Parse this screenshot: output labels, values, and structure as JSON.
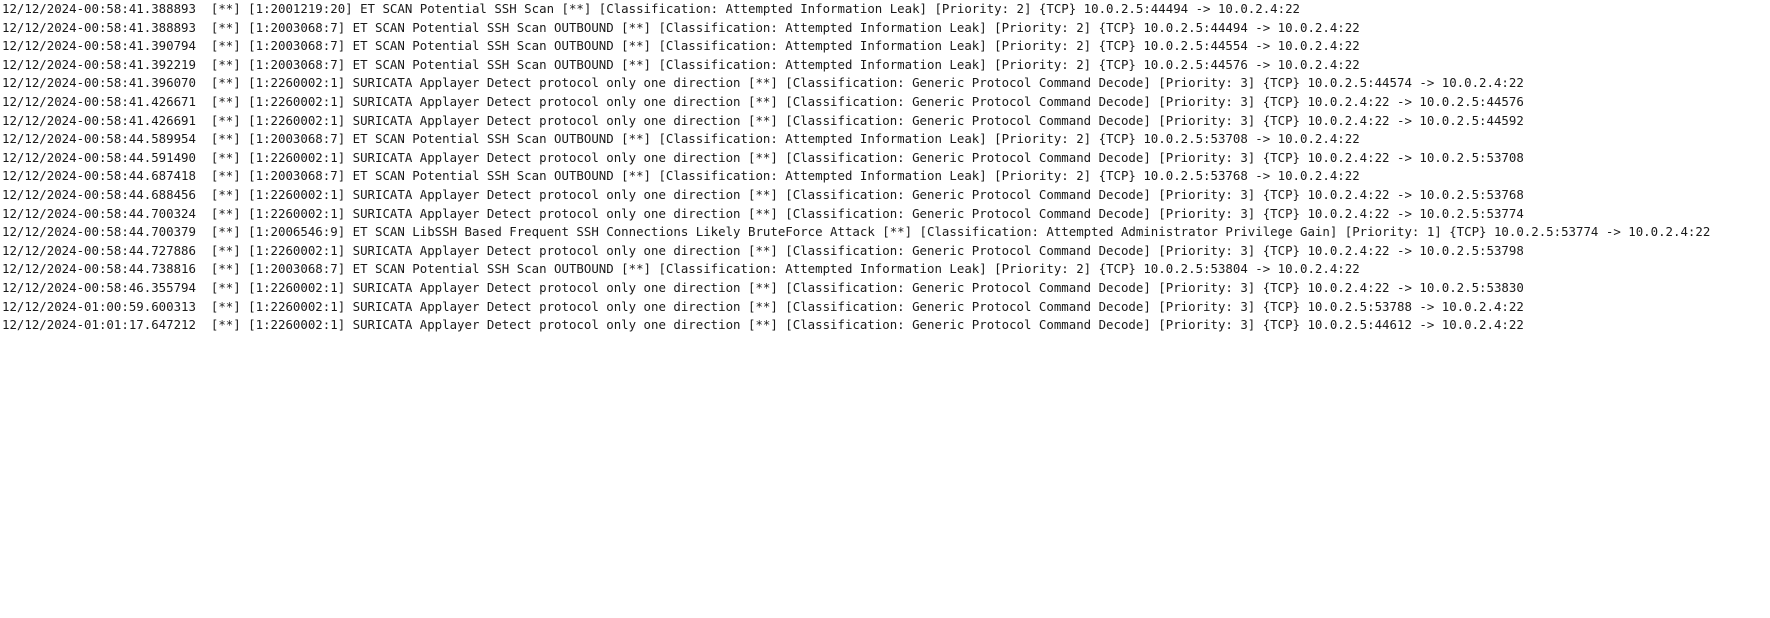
{
  "log_lines": [
    "12/12/2024-00:58:41.388893  [**] [1:2001219:20] ET SCAN Potential SSH Scan [**] [Classification: Attempted Information Leak] [Priority: 2] {TCP} 10.0.2.5:44494 -> 10.0.2.4:22",
    "12/12/2024-00:58:41.388893  [**] [1:2003068:7] ET SCAN Potential SSH Scan OUTBOUND [**] [Classification: Attempted Information Leak] [Priority: 2] {TCP} 10.0.2.5:44494 -> 10.0.2.4:22",
    "12/12/2024-00:58:41.390794  [**] [1:2003068:7] ET SCAN Potential SSH Scan OUTBOUND [**] [Classification: Attempted Information Leak] [Priority: 2] {TCP} 10.0.2.5:44554 -> 10.0.2.4:22",
    "12/12/2024-00:58:41.392219  [**] [1:2003068:7] ET SCAN Potential SSH Scan OUTBOUND [**] [Classification: Attempted Information Leak] [Priority: 2] {TCP} 10.0.2.5:44576 -> 10.0.2.4:22",
    "12/12/2024-00:58:41.396070  [**] [1:2260002:1] SURICATA Applayer Detect protocol only one direction [**] [Classification: Generic Protocol Command Decode] [Priority: 3] {TCP} 10.0.2.5:44574 -> 10.0.2.4:22",
    "12/12/2024-00:58:41.426671  [**] [1:2260002:1] SURICATA Applayer Detect protocol only one direction [**] [Classification: Generic Protocol Command Decode] [Priority: 3] {TCP} 10.0.2.4:22 -> 10.0.2.5:44576",
    "12/12/2024-00:58:41.426691  [**] [1:2260002:1] SURICATA Applayer Detect protocol only one direction [**] [Classification: Generic Protocol Command Decode] [Priority: 3] {TCP} 10.0.2.4:22 -> 10.0.2.5:44592",
    "12/12/2024-00:58:44.589954  [**] [1:2003068:7] ET SCAN Potential SSH Scan OUTBOUND [**] [Classification: Attempted Information Leak] [Priority: 2] {TCP} 10.0.2.5:53708 -> 10.0.2.4:22",
    "12/12/2024-00:58:44.591490  [**] [1:2260002:1] SURICATA Applayer Detect protocol only one direction [**] [Classification: Generic Protocol Command Decode] [Priority: 3] {TCP} 10.0.2.4:22 -> 10.0.2.5:53708",
    "12/12/2024-00:58:44.687418  [**] [1:2003068:7] ET SCAN Potential SSH Scan OUTBOUND [**] [Classification: Attempted Information Leak] [Priority: 2] {TCP} 10.0.2.5:53768 -> 10.0.2.4:22",
    "12/12/2024-00:58:44.688456  [**] [1:2260002:1] SURICATA Applayer Detect protocol only one direction [**] [Classification: Generic Protocol Command Decode] [Priority: 3] {TCP} 10.0.2.4:22 -> 10.0.2.5:53768",
    "12/12/2024-00:58:44.700324  [**] [1:2260002:1] SURICATA Applayer Detect protocol only one direction [**] [Classification: Generic Protocol Command Decode] [Priority: 3] {TCP} 10.0.2.4:22 -> 10.0.2.5:53774",
    "12/12/2024-00:58:44.700379  [**] [1:2006546:9] ET SCAN LibSSH Based Frequent SSH Connections Likely BruteForce Attack [**] [Classification: Attempted Administrator Privilege Gain] [Priority: 1] {TCP} 10.0.2.5:53774 -> 10.0.2.4:22",
    "12/12/2024-00:58:44.727886  [**] [1:2260002:1] SURICATA Applayer Detect protocol only one direction [**] [Classification: Generic Protocol Command Decode] [Priority: 3] {TCP} 10.0.2.4:22 -> 10.0.2.5:53798",
    "12/12/2024-00:58:44.738816  [**] [1:2003068:7] ET SCAN Potential SSH Scan OUTBOUND [**] [Classification: Attempted Information Leak] [Priority: 2] {TCP} 10.0.2.5:53804 -> 10.0.2.4:22",
    "12/12/2024-00:58:46.355794  [**] [1:2260002:1] SURICATA Applayer Detect protocol only one direction [**] [Classification: Generic Protocol Command Decode] [Priority: 3] {TCP} 10.0.2.4:22 -> 10.0.2.5:53830",
    "12/12/2024-01:00:59.600313  [**] [1:2260002:1] SURICATA Applayer Detect protocol only one direction [**] [Classification: Generic Protocol Command Decode] [Priority: 3] {TCP} 10.0.2.5:53788 -> 10.0.2.4:22",
    "12/12/2024-01:01:17.647212  [**] [1:2260002:1] SURICATA Applayer Detect protocol only one direction [**] [Classification: Generic Protocol Command Decode] [Priority: 3] {TCP} 10.0.2.5:44612 -> 10.0.2.4:22"
  ]
}
